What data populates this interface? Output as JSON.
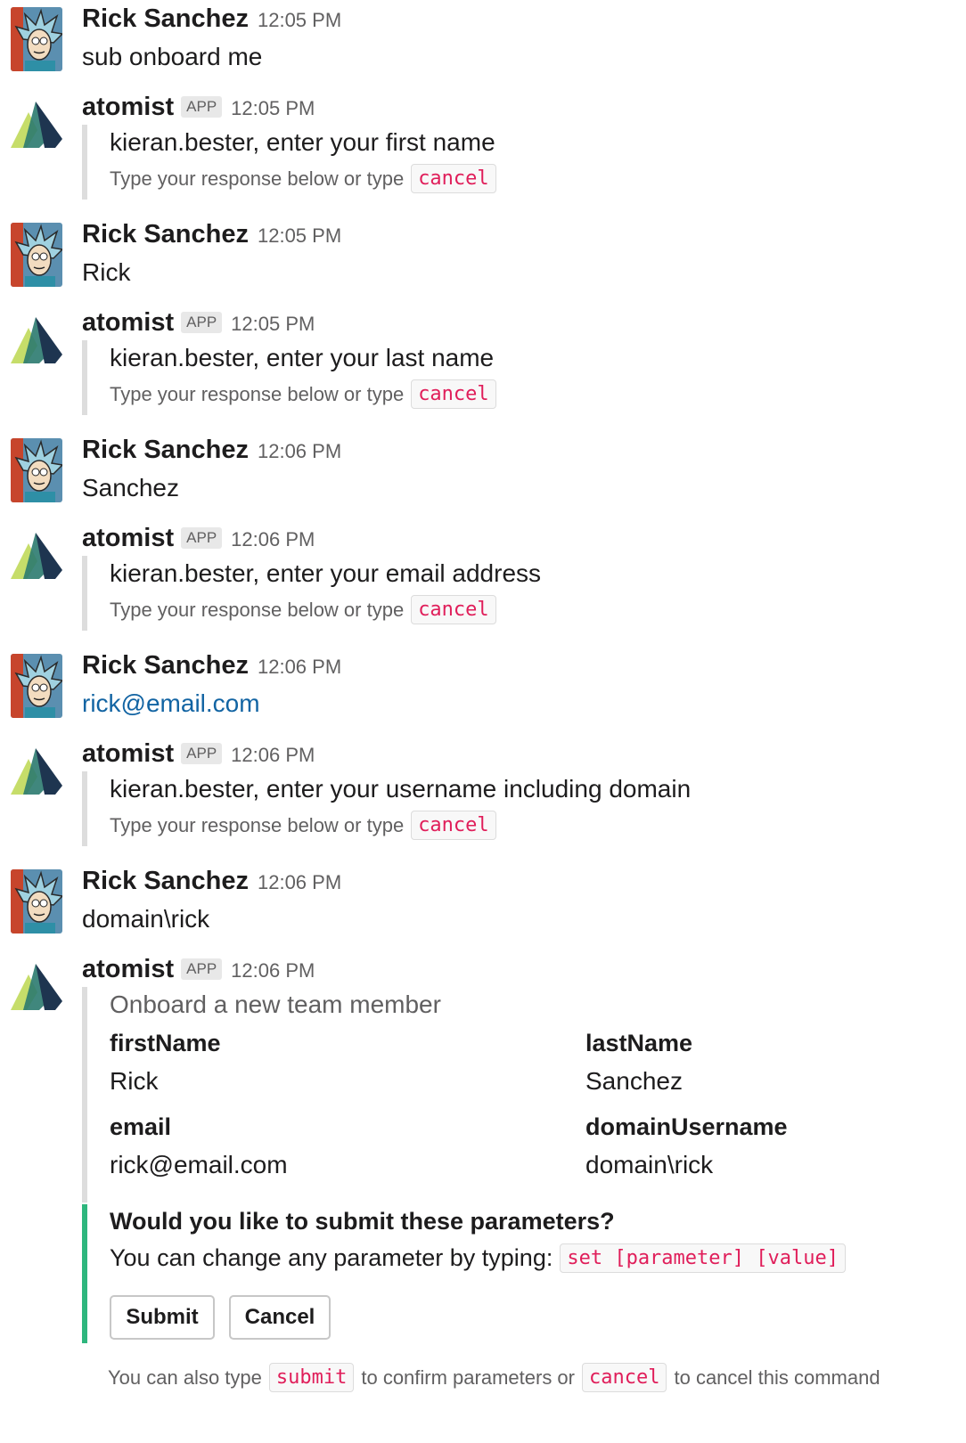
{
  "messages": [
    {
      "sender": "Rick Sanchez",
      "time": "12:05 PM",
      "text": "sub onboard me"
    },
    {
      "sender": "atomist",
      "badge": "APP",
      "time": "12:05 PM",
      "prompt": "kieran.bester, enter your first name",
      "hint": "Type your response below or type",
      "hint_code": "cancel"
    },
    {
      "sender": "Rick Sanchez",
      "time": "12:05 PM",
      "text": "Rick"
    },
    {
      "sender": "atomist",
      "badge": "APP",
      "time": "12:05 PM",
      "prompt": "kieran.bester, enter your last name",
      "hint": "Type your response below or type",
      "hint_code": "cancel"
    },
    {
      "sender": "Rick Sanchez",
      "time": "12:06 PM",
      "text": "Sanchez"
    },
    {
      "sender": "atomist",
      "badge": "APP",
      "time": "12:06 PM",
      "prompt": "kieran.bester, enter your email address",
      "hint": "Type your response below or type",
      "hint_code": "cancel"
    },
    {
      "sender": "Rick Sanchez",
      "time": "12:06 PM",
      "text": "rick@email.com"
    },
    {
      "sender": "atomist",
      "badge": "APP",
      "time": "12:06 PM",
      "prompt": "kieran.bester, enter your username including domain",
      "hint": "Type your response below or type",
      "hint_code": "cancel"
    },
    {
      "sender": "Rick Sanchez",
      "time": "12:06 PM",
      "text": "domain\\rick"
    },
    {
      "sender": "atomist",
      "badge": "APP",
      "time": "12:06 PM"
    }
  ],
  "summary": {
    "title": "Onboard a new team member",
    "fields": [
      {
        "label": "firstName",
        "value": "Rick"
      },
      {
        "label": "lastName",
        "value": "Sanchez"
      },
      {
        "label": "email",
        "value": "rick@email.com"
      },
      {
        "label": "domainUsername",
        "value": "domain\\rick"
      }
    ]
  },
  "confirm": {
    "question": "Would you like to submit these parameters?",
    "change_text": "You can change any parameter by typing:",
    "change_code": "set [parameter] [value]",
    "submit_label": "Submit",
    "cancel_label": "Cancel"
  },
  "footer": {
    "part1": "You can also type",
    "code1": "submit",
    "part2": "to confirm parameters or",
    "code2": "cancel",
    "part3": "to cancel this command"
  },
  "colors": {
    "link": "#1264a3",
    "code": "#e01e5a",
    "accent_green": "#2eb67d",
    "quote_bar": "#dddddd"
  }
}
